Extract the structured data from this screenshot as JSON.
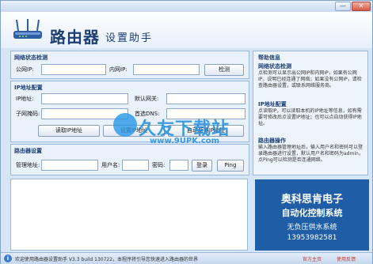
{
  "window": {
    "close_glyph": "✕",
    "minimize_glyph": "—"
  },
  "header": {
    "title": "路由器",
    "subtitle": "设置助手"
  },
  "network_detect": {
    "title": "网络状态检测",
    "public_ip_label": "公网IP:",
    "public_ip_value": "",
    "lan_ip_label": "内网IP:",
    "lan_ip_value": "",
    "detect_button": "检测"
  },
  "ip_config": {
    "title": "IP地址配置",
    "ip_label": "IP地址:",
    "gateway_label": "默认网关:",
    "subnet_label": "子网掩码:",
    "dns_label": "首选DNS:",
    "btn_read": "读取IP地址",
    "btn_set": "设置IP地址",
    "btn_auto": "自动获得IP地址"
  },
  "router_settings": {
    "title": "路由器设置",
    "mgmt_label": "管理地址:",
    "user_label": "用户名:",
    "pass_label": "密码:",
    "login_button": "登录",
    "ping_button": "Ping"
  },
  "help": {
    "title": "帮助信息",
    "sec1_title": "网络状态检测",
    "sec1_text": "点检测可以显示出公网IP和内网IP，如果有公网IP，说明已经连通了网络；如果没有公网IP，请检查路由器设置，或联系网络服务商。",
    "sec2_title": "IP地址配置",
    "sec2_text": "点读取IP，可以读取本机的IP地址等信息，如有需要可修改后点设置IP地址；也可以点自动获得IP地址。",
    "sec3_title": "路由器操作",
    "sec3_text": "输入路由器管理地址后，输入用户名和密码可以登录路由器进行设置，默认用户名和密码为admin，点Ping可以检测是否连通网络。"
  },
  "ad": {
    "line1": "奥科思肯电子",
    "line2": "自动化控制系统",
    "line3": "无负压供水系统",
    "phone": "13953982581"
  },
  "watermark": {
    "text": "久友下载站",
    "url": "www.9UPK.com"
  },
  "status": {
    "text": "欢迎使用路由器设置助手 V3.3 build 130722，本程序将引导您快速进入路由器的世界",
    "link_home": "官方主页",
    "link_feedback": "使用反馈"
  }
}
